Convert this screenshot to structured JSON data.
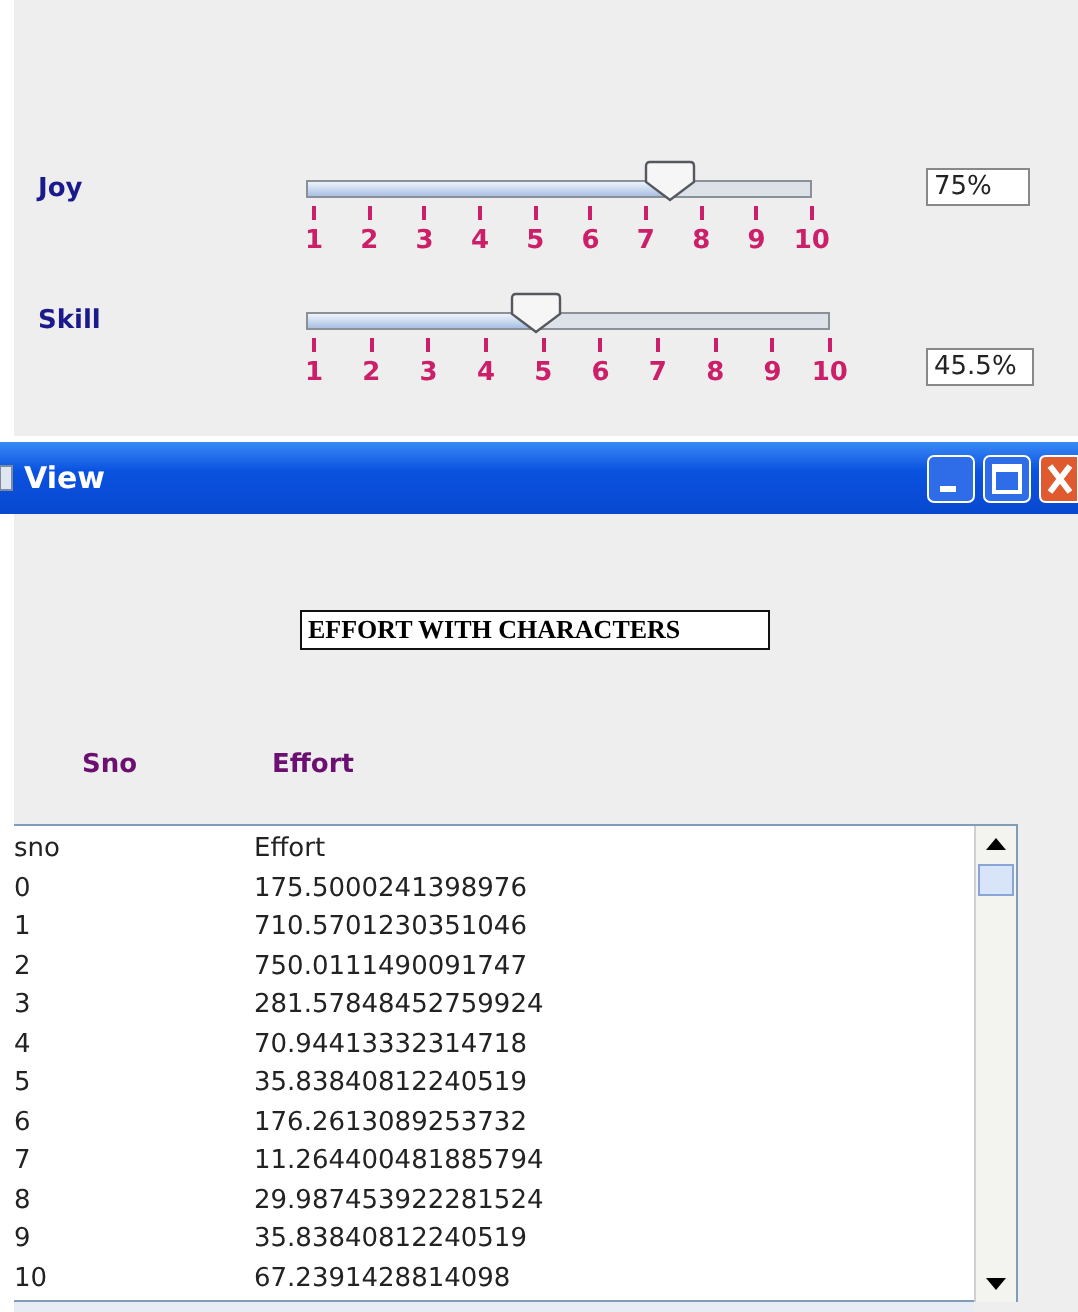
{
  "sliders": [
    {
      "label": "Joy",
      "level": 0.72,
      "ticks": [
        "1",
        "2",
        "3",
        "4",
        "5",
        "6",
        "7",
        "8",
        "9",
        "10"
      ],
      "value": "75%"
    },
    {
      "label": "Skill",
      "level": 0.44,
      "ticks": [
        "1",
        "2",
        "3",
        "4",
        "5",
        "6",
        "7",
        "8",
        "9",
        "10"
      ],
      "value": "45.5%"
    }
  ],
  "window": {
    "title": "View"
  },
  "heading": "EFFORT WITH CHARACTERS",
  "labels": [
    "Sno",
    "Effort"
  ],
  "table": {
    "columns": [
      "sno",
      "Effort"
    ],
    "rows": [
      [
        "0",
        "175.5000241398976"
      ],
      [
        "1",
        "710.5701230351046"
      ],
      [
        "2",
        "750.0111490091747"
      ],
      [
        "3",
        "281.57848452759924"
      ],
      [
        "4",
        "70.94413332314718"
      ],
      [
        "5",
        "35.83840812240519"
      ],
      [
        "6",
        "176.2613089253732"
      ],
      [
        "7",
        "11.264400481885794"
      ],
      [
        "8",
        "29.987453922281524"
      ],
      [
        "9",
        "35.83840812240519"
      ],
      [
        "10",
        "67.2391428814098"
      ]
    ]
  }
}
